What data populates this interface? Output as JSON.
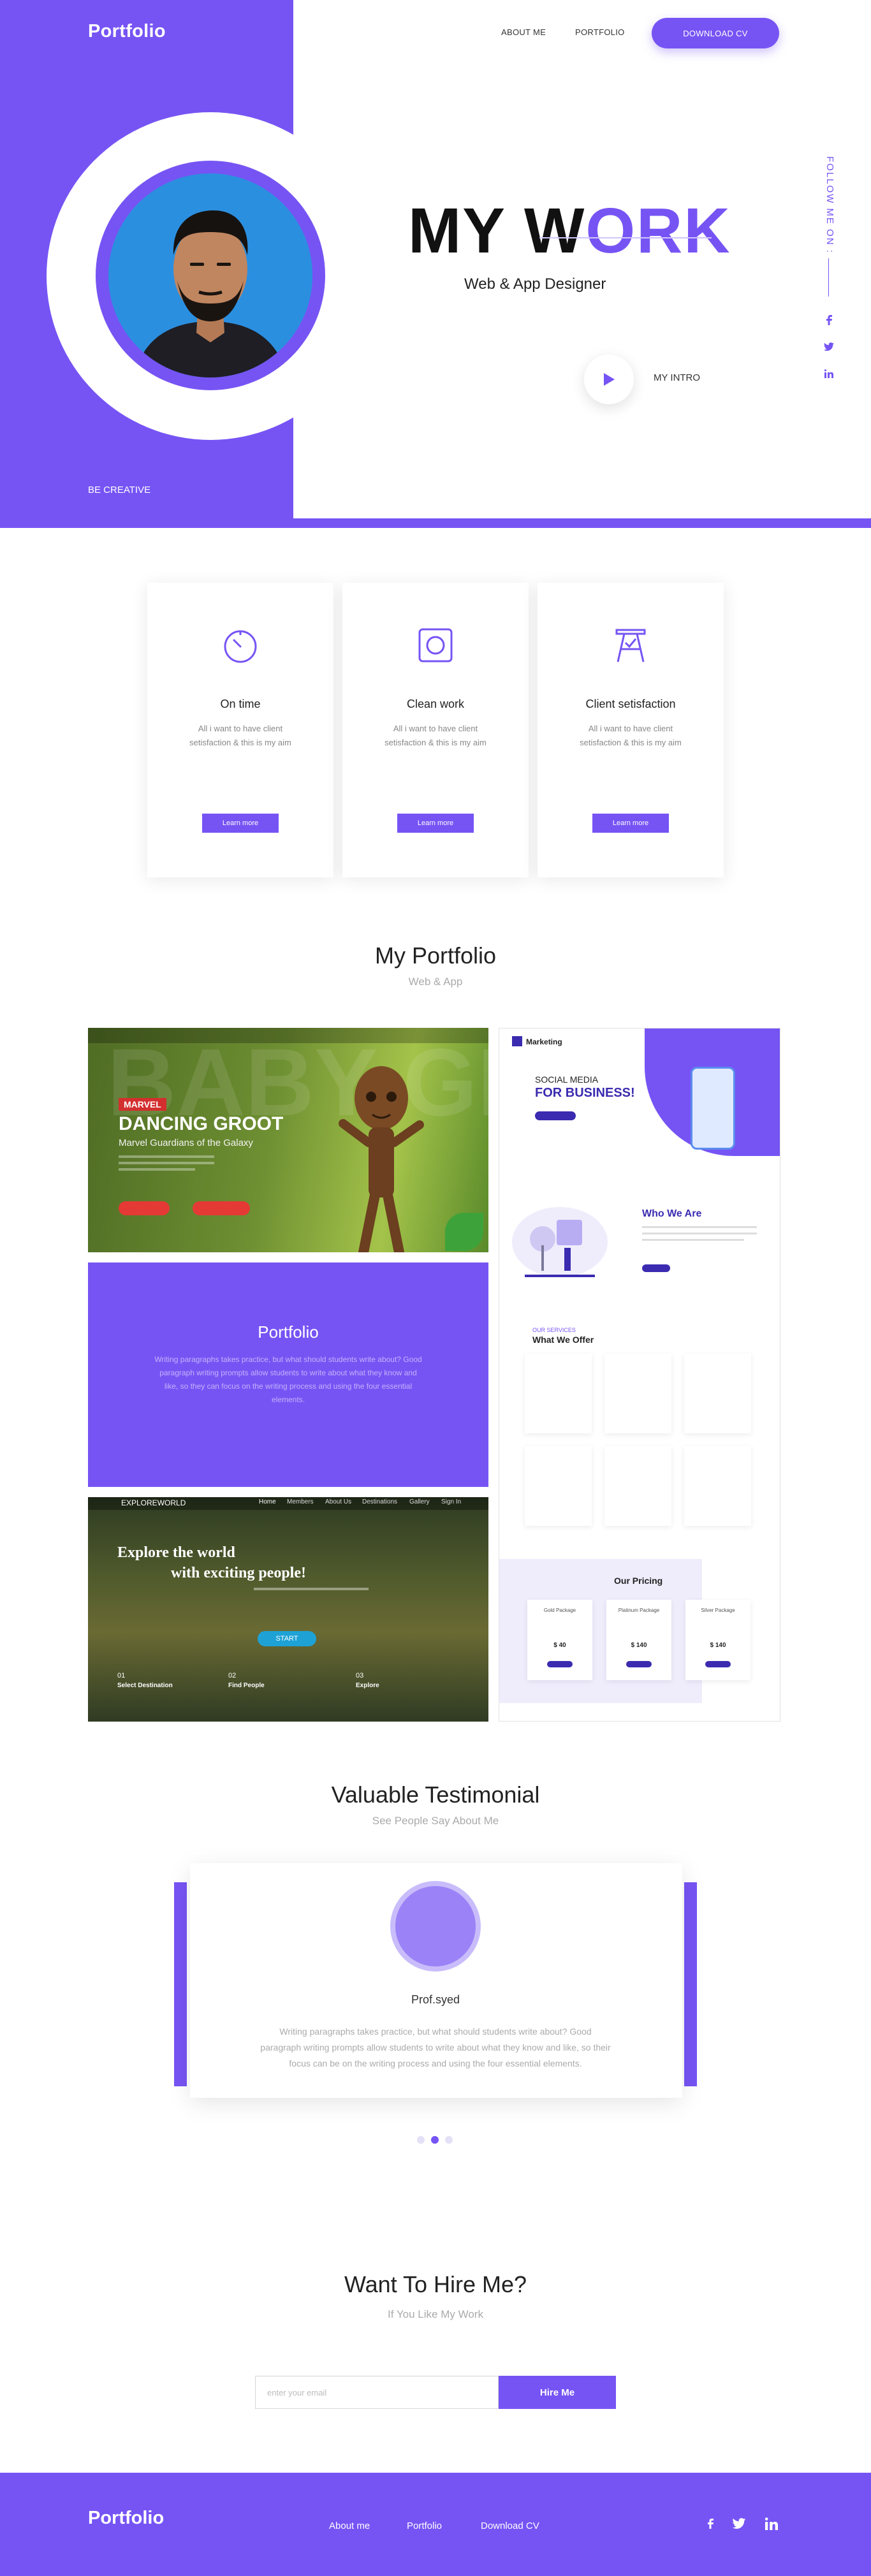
{
  "header": {
    "brand": "Portfolio",
    "nav": [
      "ABOUT ME",
      "PORTFOLIO"
    ],
    "cta": "DOWNLOAD CV"
  },
  "hero": {
    "title_dark": "MY W",
    "title_purple": "ORK",
    "subtitle": "Web & App Designer",
    "intro": "MY INTRO",
    "tagline": "BE CREATIVE",
    "follow": "FOLLOW ME ON :",
    "social": [
      "facebook-icon",
      "twitter-icon",
      "linkedin-icon"
    ]
  },
  "features": [
    {
      "icon": "timer-icon",
      "title": "On time",
      "text": "All i want to have client setisfaction & this is my aim",
      "button": "Learn more"
    },
    {
      "icon": "square-icon",
      "title": "Clean work",
      "text": "All i want to have client setisfaction & this is my aim",
      "button": "Learn more"
    },
    {
      "icon": "easel-icon",
      "title": "Client setisfaction",
      "text": "All i want to have client setisfaction & this is my aim",
      "button": "Learn more"
    }
  ],
  "portfolio": {
    "title": "My Portfolio",
    "subtitle": "Web & App",
    "groot": {
      "badge": "MARVEL",
      "title": "DANCING GROOT",
      "subtitle": "Marvel Guardians of the Galaxy",
      "bg_word": "BABY GROOT"
    },
    "card": {
      "title": "Portfolio",
      "text": "Writing paragraphs takes practice, but what should students write about? Good paragraph writing prompts allow students to write about what they know and like, so they can focus on the writing process and using the four essential elements."
    },
    "forest": {
      "brand": "EXPLOREWORLD",
      "nav": [
        "Home",
        "Members",
        "About Us",
        "Destinations",
        "Gallery",
        "Sign In"
      ],
      "headline1": "Explore the world",
      "headline2": "with exciting people!",
      "button": "START",
      "steps": [
        {
          "num": "01",
          "label": "Select Destination"
        },
        {
          "num": "02",
          "label": "Find People"
        },
        {
          "num": "03",
          "label": "Explore"
        }
      ]
    },
    "marketing": {
      "brand": "Marketing",
      "hero1": "SOCIAL MEDIA",
      "hero2": "FOR BUSINESS!",
      "who": "Who We Are",
      "offer_small": "OUR SERVICES",
      "offer": "What We Offer",
      "pricing": "Our Pricing",
      "plans": [
        {
          "name": "Gold Package",
          "price": "$ 40"
        },
        {
          "name": "Platinum Package",
          "price": "$ 140"
        },
        {
          "name": "Silver Package",
          "price": "$ 140"
        }
      ]
    }
  },
  "testimonial": {
    "title": "Valuable Testimonial",
    "subtitle": "See People Say About Me",
    "name": "Prof.syed",
    "text": "Writing paragraphs takes practice, but what should students write about? Good paragraph writing prompts allow students to write about what they know and like, so their focus can be on the writing process and using the four essential elements."
  },
  "hire": {
    "title": "Want To Hire Me?",
    "subtitle": "If You Like My Work",
    "placeholder": "enter your email",
    "button": "Hire Me"
  },
  "footer": {
    "brand": "Portfolio",
    "links": [
      "About me",
      "Portfolio",
      "Download CV"
    ],
    "social": [
      "facebook-icon",
      "twitter-icon",
      "linkedin-icon"
    ]
  },
  "colors": {
    "accent": "#7654f4",
    "accent_light": "#9b82f7"
  }
}
